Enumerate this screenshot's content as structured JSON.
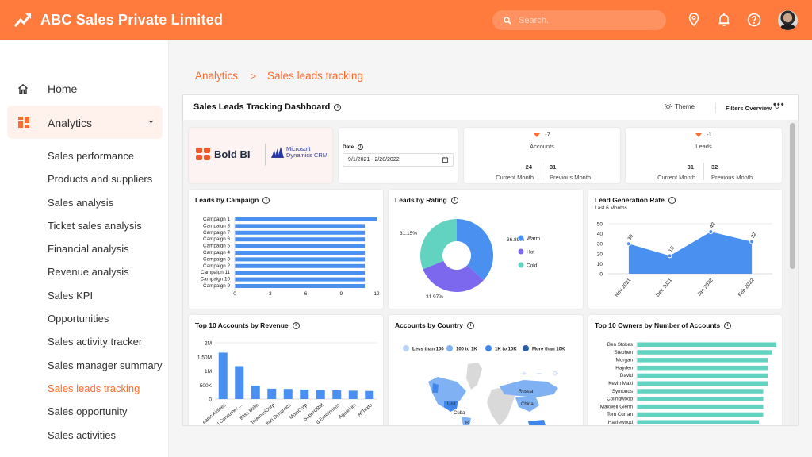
{
  "app": {
    "title": "ABC Sales Private Limited",
    "brand_icon": "trending-up-icon",
    "brand_color": "#ff7a3d",
    "accent_color": "#ff6b2c"
  },
  "header": {
    "search_placeholder": "Search..",
    "icons": [
      "location-pin-icon",
      "bell-icon",
      "help-circle-icon",
      "user-avatar"
    ]
  },
  "sidebar": {
    "home_label": "Home",
    "analytics_label": "Analytics",
    "sub_items": [
      {
        "label": "Sales performance",
        "active": false
      },
      {
        "label": "Products and suppliers",
        "active": false
      },
      {
        "label": "Sales analysis",
        "active": false
      },
      {
        "label": "Ticket sales analysis",
        "active": false
      },
      {
        "label": "Financial analysis",
        "active": false
      },
      {
        "label": "Revenue analysis",
        "active": false
      },
      {
        "label": "Sales KPI",
        "active": false
      },
      {
        "label": "Opportunities",
        "active": false
      },
      {
        "label": "Sales activity tracker",
        "active": false
      },
      {
        "label": "Sales manager summary",
        "active": false
      },
      {
        "label": "Sales leads tracking",
        "active": true
      },
      {
        "label": "Sales opportunity",
        "active": false
      },
      {
        "label": "Sales activities",
        "active": false
      }
    ]
  },
  "breadcrumb": {
    "parent": "Analytics",
    "separator": ">",
    "current": "Sales leads tracking"
  },
  "dashboard": {
    "title": "Sales Leads Tracking Dashboard",
    "theme_label": "Theme",
    "filters_label": "Filters Overview",
    "more_label": "•••",
    "logos": {
      "bold_bi": "Bold BI",
      "ms_line1": "Microsoft",
      "ms_line2": "Dynamics CRM"
    },
    "date": {
      "label": "Date",
      "value": "9/1/2021 - 2/28/2022"
    },
    "kpis": [
      {
        "name": "Accounts",
        "delta": "-7",
        "current": "24",
        "previous": "31",
        "current_label": "Current Month",
        "previous_label": "Previous Month"
      },
      {
        "name": "Leads",
        "delta": "-1",
        "current": "31",
        "previous": "32",
        "current_label": "Current Month",
        "previous_label": "Previous Month"
      }
    ]
  },
  "chart_data": [
    {
      "type": "bar",
      "orientation": "horizontal",
      "title": "Leads by Campaign",
      "categories": [
        "Campaign 1",
        "Campaign 8",
        "Campaign 7",
        "Campaign 6",
        "Campaign 5",
        "Campaign 4",
        "Campaign 3",
        "Campaign 2",
        "Campaign 11",
        "Campaign 10",
        "Campaign 9"
      ],
      "values": [
        12,
        11,
        11,
        11,
        11,
        11,
        11,
        11,
        11,
        11,
        11
      ],
      "xlim": [
        0,
        12
      ],
      "xticks": [
        "0",
        "3",
        "6",
        "9",
        "12"
      ],
      "color": "#4a90f0"
    },
    {
      "type": "pie",
      "donut": true,
      "title": "Leads by Rating",
      "labels": [
        "Warm",
        "Hot",
        "Cold"
      ],
      "values": [
        36.89,
        31.97,
        31.15
      ],
      "value_labels": [
        "36.89%",
        "31.97%",
        "31.15%"
      ],
      "colors": [
        "#4a90f0",
        "#7b68ee",
        "#62d3c0"
      ],
      "legend": "right"
    },
    {
      "type": "area",
      "title": "Lead Generation Rate",
      "subtitle": "Last 6 Months",
      "categories": [
        "Nov 2021",
        "Dec 2021",
        "Jan 2022",
        "Feb 2022"
      ],
      "values": [
        30,
        18,
        42,
        32
      ],
      "ylim": [
        0,
        50
      ],
      "yticks": [
        "0",
        "10",
        "20",
        "30",
        "40",
        "50"
      ],
      "color": "#4a90f0"
    },
    {
      "type": "bar",
      "title": "Top 10 Accounts by Revenue",
      "categories": [
        "Oceanic Airlines",
        "Consumer ...",
        "Bliss Belle",
        "TelAmeriCorp",
        "Titan Dynamics",
        "MomCorp",
        "SuperCRM",
        "Enterprises",
        "Aquarium",
        "AllTexto"
      ],
      "category_labels": [
        "eanic Airlines",
        "l Consumer ...",
        "Bliss Belle",
        "TelAmeriCorp",
        "itan Dynamics",
        "MomCorp",
        "SuperCRM",
        "d Enterprises",
        "Aquarium",
        "AllTexto"
      ],
      "values": [
        1650000,
        1170000,
        480000,
        370000,
        360000,
        340000,
        320000,
        310000,
        300000,
        290000
      ],
      "ylim": [
        0,
        2000000
      ],
      "yticks": [
        "0",
        "500K",
        "1M",
        "1.50M",
        "2M"
      ],
      "color": "#4a90f0"
    },
    {
      "type": "map",
      "title": "Accounts by Country",
      "legend": [
        {
          "label": "Less than 100",
          "color": "#b8d4f8"
        },
        {
          "label": "100 to 1K",
          "color": "#7fb1f3"
        },
        {
          "label": "1K to 10K",
          "color": "#3f86ea"
        },
        {
          "label": "More than 10K",
          "color": "#2a5fa8"
        }
      ],
      "visible_country_labels": [
        "Russia",
        "China",
        "Unit..",
        "Cuba",
        "B..."
      ]
    },
    {
      "type": "bar",
      "orientation": "horizontal",
      "title": "Top 10 Owners by Number of Accounts",
      "categories": [
        "Ben Stokes",
        "Stephen",
        "Morgan",
        "Hayden",
        "David",
        "Kevin Maxi",
        "Symonds",
        "Colingwood",
        "Maxwell Glenn",
        "Tom Curran",
        "Hazlewood"
      ],
      "values": [
        3.2,
        3.1,
        3.0,
        3.0,
        3.0,
        3.0,
        2.9,
        2.9,
        2.9,
        2.9,
        2.8
      ],
      "color": "#62d3c0"
    }
  ]
}
